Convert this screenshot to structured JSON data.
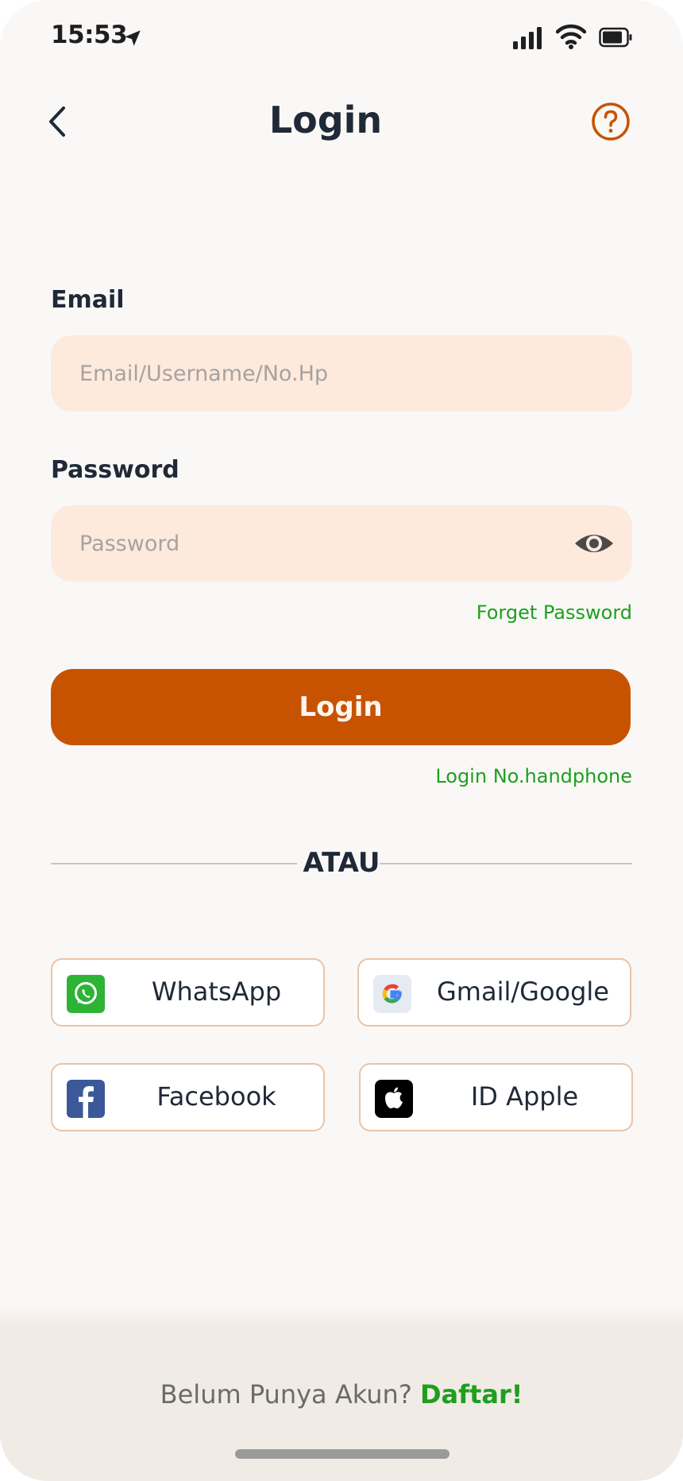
{
  "status_bar": {
    "time": "15:53",
    "icons": [
      "location-arrow-icon",
      "cellular-signal-icon",
      "wifi-icon",
      "battery-icon"
    ]
  },
  "header": {
    "title": "Login",
    "back_icon": "chevron-left-icon",
    "help_icon": "question-circle-icon"
  },
  "form": {
    "email_label": "Email",
    "email_placeholder": "Email/Username/No.Hp",
    "email_value": "",
    "password_label": "Password",
    "password_placeholder": "Password",
    "password_value": "",
    "forget_password": "Forget Password",
    "login_button": "Login",
    "login_phone": "Login No.handphone"
  },
  "divider": {
    "text": "ATAU"
  },
  "social": [
    {
      "label": "WhatsApp",
      "icon": "whatsapp-icon"
    },
    {
      "label": "Gmail/Google",
      "icon": "google-icon"
    },
    {
      "label": "Facebook",
      "icon": "facebook-icon"
    },
    {
      "label": "ID Apple",
      "icon": "apple-icon"
    }
  ],
  "footer": {
    "prompt": "Belum Punya Akun?",
    "signup": "Daftar!"
  },
  "colors": {
    "primary": "#c75300",
    "link_green": "#1e9f1e",
    "input_background": "#feeadd",
    "social_border": "#eac3a7",
    "screen_background": "#faf8f7",
    "footer_background": "#f1ebe6"
  }
}
